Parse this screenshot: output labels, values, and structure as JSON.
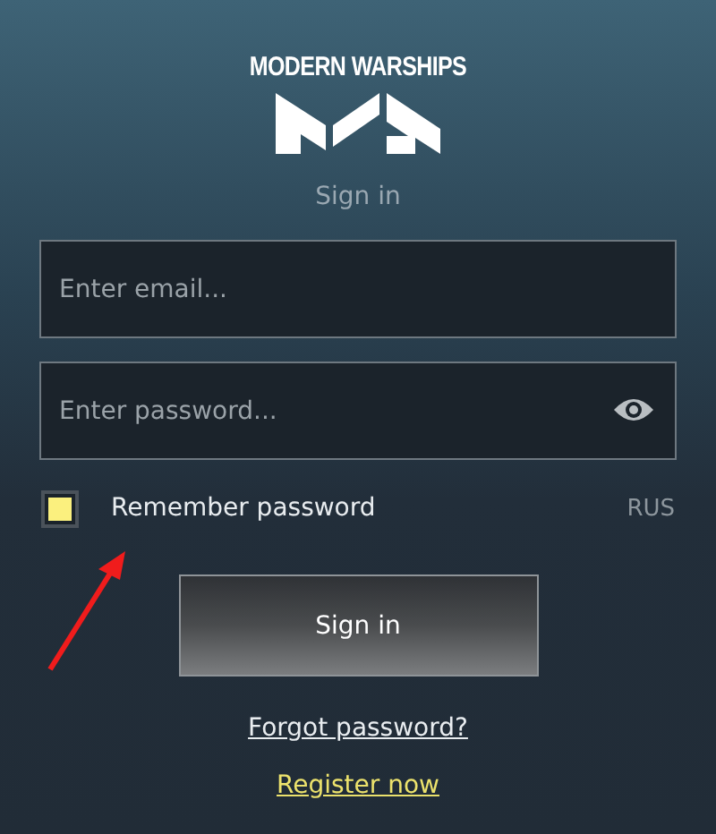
{
  "logo": {
    "text": "MODERN WARSHIPS"
  },
  "heading": "Sign in",
  "email": {
    "placeholder": "Enter email..."
  },
  "password": {
    "placeholder": "Enter password..."
  },
  "remember": {
    "label": "Remember password",
    "checked": true
  },
  "language": "RUS",
  "sign_in_button": "Sign in",
  "forgot_link": "Forgot password?",
  "register_link": "Register now"
}
